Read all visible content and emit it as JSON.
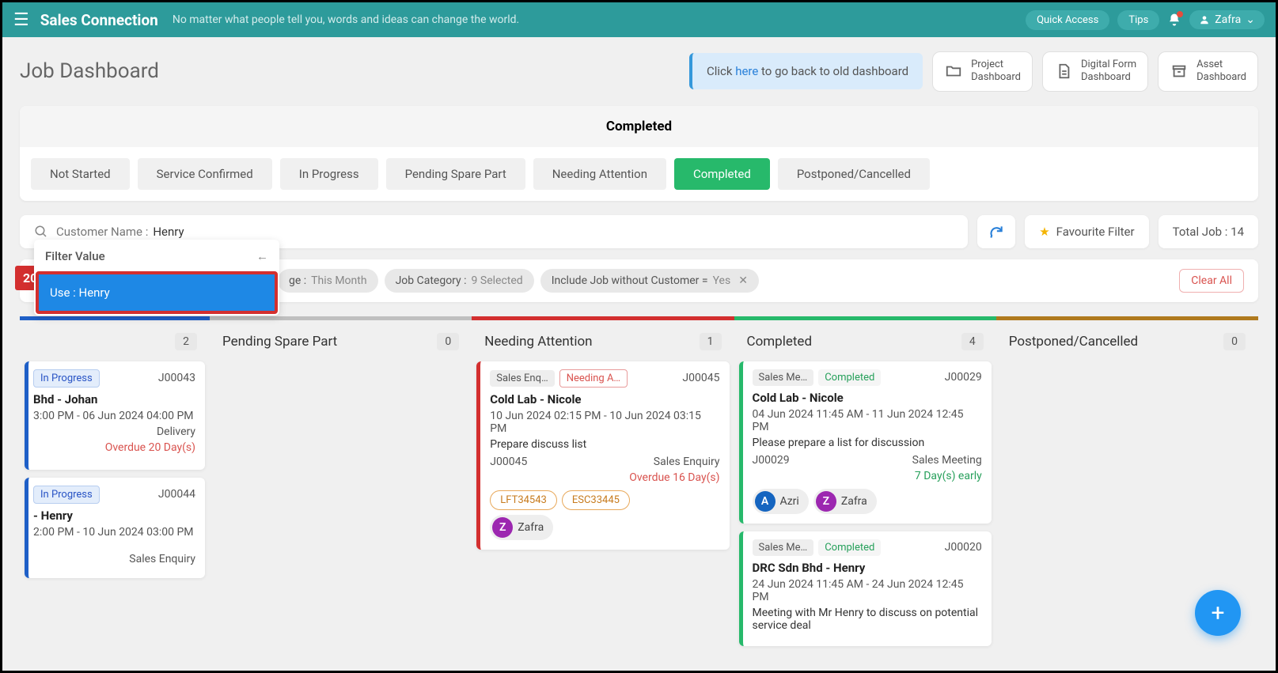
{
  "topbar": {
    "brand": "Sales Connection",
    "tagline": "No matter what people tell you, words and ideas can change the world.",
    "quick_access": "Quick Access",
    "tips": "Tips",
    "user_name": "Zafra"
  },
  "page": {
    "title": "Job Dashboard",
    "banner_pre": "Click ",
    "banner_link": "here",
    "banner_post": " to go back to old dashboard",
    "dash_buttons": [
      {
        "line1": "Project",
        "line2": "Dashboard"
      },
      {
        "line1": "Digital Form",
        "line2": "Dashboard"
      },
      {
        "line1": "Asset",
        "line2": "Dashboard"
      }
    ]
  },
  "completed_panel_title": "Completed",
  "status_tabs": [
    "Not Started",
    "Service Confirmed",
    "In Progress",
    "Pending Spare Part",
    "Needing Attention",
    "Completed",
    "Postponed/Cancelled"
  ],
  "active_tab": "Completed",
  "search": {
    "label": "Customer Name : ",
    "value": "Henry"
  },
  "favorite_filter_label": "Favourite Filter",
  "total_job_label": "Total Job : 14",
  "red_badge": "20",
  "filter_dd": {
    "title": "Filter Value",
    "item": "Use : Henry"
  },
  "chips": [
    {
      "label": "ge : ",
      "value": "This Month"
    },
    {
      "label": "Job Category : ",
      "value": "9 Selected"
    },
    {
      "label": "Include Job without Customer = ",
      "value": "Yes",
      "closable": true
    }
  ],
  "clear_all": "Clear All",
  "columns": [
    {
      "key": "in_progress",
      "title": "",
      "count": "2"
    },
    {
      "key": "pending",
      "title": "Pending Spare Part",
      "count": "0"
    },
    {
      "key": "needing",
      "title": "Needing Attention",
      "count": "1"
    },
    {
      "key": "completed",
      "title": "Completed",
      "count": "4"
    },
    {
      "key": "postponed",
      "title": "Postponed/Cancelled",
      "count": "0"
    }
  ],
  "cards": {
    "col1": [
      {
        "status_tag": "In Progress",
        "job": "J00043",
        "title": "Bhd - Johan",
        "time": "3:00 PM - 06 Jun 2024 04:00 PM",
        "meta_right": "Delivery",
        "status_text": "Overdue 20 Day(s)"
      },
      {
        "status_tag": "In Progress",
        "job": "J00044",
        "title": "- Henry",
        "time": "2:00 PM - 10 Jun 2024 03:00 PM",
        "meta_right": "Sales Enquiry"
      }
    ],
    "needing": {
      "tag1": "Sales Enq…",
      "tag2": "Needing A…",
      "job": "J00045",
      "title": "Cold Lab - Nicole",
      "time": "10 Jun 2024 02:15 PM - 10 Jun 2024 03:15 PM",
      "desc": "Prepare discuss list",
      "job2": "J00045",
      "type": "Sales Enquiry",
      "status_text": "Overdue 16 Day(s)",
      "pills": [
        "LFT34543",
        "ESC33445"
      ],
      "assignee": "Zafra"
    },
    "completed": [
      {
        "tag1": "Sales Me…",
        "tag2": "Completed",
        "job": "J00029",
        "title": "Cold Lab - Nicole",
        "time": "04 Jun 2024 11:45 AM - 11 Jun 2024 12:45 PM",
        "desc": "Please prepare a list for discussion",
        "job2": "J00029",
        "type": "Sales Meeting",
        "status_text": "7 Day(s) early",
        "assignees": [
          {
            "letter": "A",
            "name": "Azri",
            "color": "av-blue"
          },
          {
            "letter": "Z",
            "name": "Zafra",
            "color": "av-purple"
          }
        ]
      },
      {
        "tag1": "Sales Me…",
        "tag2": "Completed",
        "job": "J00020",
        "title": "DRC Sdn Bhd - Henry",
        "time": "24 Jun 2024 11:45 AM - 24 Jun 2024 12:45 PM",
        "desc": "Meeting with Mr Henry to discuss on potential service deal"
      }
    ]
  }
}
